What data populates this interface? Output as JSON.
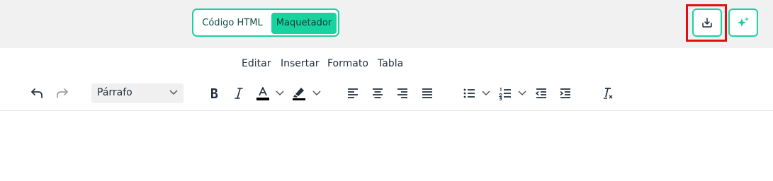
{
  "mode_toggle": {
    "html_label": "Código HTML",
    "maquetador_label": "Maquetador",
    "active": "Maquetador"
  },
  "top_actions": {
    "download_icon": "download-icon",
    "ai_icon": "sparkle-icon"
  },
  "menu": {
    "items": [
      "Editar",
      "Insertar",
      "Formato",
      "Tabla"
    ]
  },
  "toolbar": {
    "block_format": "Párrafo",
    "icons": [
      "undo-icon",
      "redo-icon",
      "bold-icon",
      "italic-icon",
      "text-color-icon",
      "highlight-color-icon",
      "align-left-icon",
      "align-center-icon",
      "align-right-icon",
      "justify-icon",
      "bullet-list-icon",
      "numbered-list-icon",
      "outdent-icon",
      "indent-icon",
      "clear-formatting-icon"
    ]
  },
  "colors": {
    "accent": "#16d39f",
    "highlight_box": "#e01010",
    "toolbar_text": "#222f3e"
  }
}
